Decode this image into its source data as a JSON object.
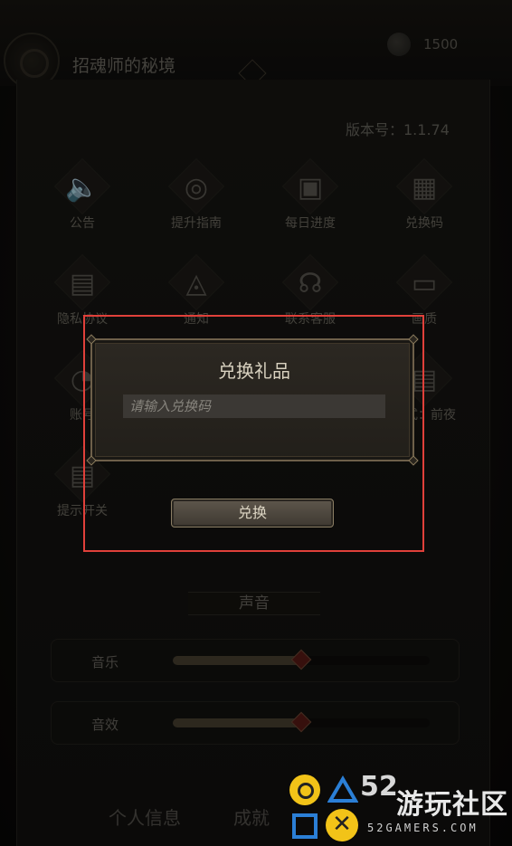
{
  "header": {
    "game_title": "招魂师的秘境",
    "currency_amount": "1500"
  },
  "settings": {
    "version_label": "版本号：1.1.74",
    "grid": [
      {
        "label": "公告",
        "icon": "speaker-icon",
        "glyph": "🔈"
      },
      {
        "label": "提升指南",
        "icon": "compass-icon",
        "glyph": "◎"
      },
      {
        "label": "每日进度",
        "icon": "calendar-check-icon",
        "glyph": "▣"
      },
      {
        "label": "兑换码",
        "icon": "qr-code-icon",
        "glyph": "▦"
      },
      {
        "label": "隐私协议",
        "icon": "document-icon",
        "glyph": "▤"
      },
      {
        "label": "通知",
        "icon": "bell-icon",
        "glyph": "◬"
      },
      {
        "label": "联系客服",
        "icon": "headset-icon",
        "glyph": "☊"
      },
      {
        "label": "画质",
        "icon": "image-icon",
        "glyph": "▭"
      },
      {
        "label": "账号",
        "icon": "account-icon",
        "glyph": "◔"
      },
      {
        "label": "模式：前夜",
        "icon": "mode-icon",
        "glyph": "▤"
      },
      {
        "label": "提示开关",
        "icon": "tips-icon",
        "glyph": "▤"
      }
    ],
    "sound": {
      "title": "声音",
      "music_label": "音乐",
      "music_level": 0.5,
      "sfx_label": "音效",
      "sfx_level": 0.5
    },
    "bottom_tabs": [
      "个人信息",
      "成就"
    ]
  },
  "dialog": {
    "title": "兑换礼品",
    "code_placeholder": "请输入兑换码",
    "code_value": "",
    "redeem_label": "兑换"
  },
  "watermark": {
    "number": "52",
    "name": "游玩社区",
    "site": "52GAMERS.COM",
    "accent_color": "#f2c318",
    "shape_color": "#2b7fd6"
  },
  "colors": {
    "highlight_box": "#e0403a",
    "dialog_border": "#6e604a"
  }
}
